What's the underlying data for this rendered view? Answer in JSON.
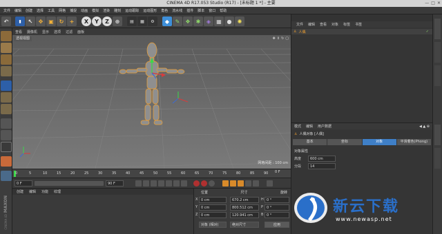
{
  "window": {
    "title": "CINEMA 4D R17.053 Studio (R17) - [未标题 1 *] - 主要",
    "controls": [
      "—",
      "□",
      "✕"
    ]
  },
  "menu": [
    "文件",
    "编辑",
    "创建",
    "选择",
    "工具",
    "网格",
    "捕捉",
    "动画",
    "模拟",
    "渲染",
    "雕刻",
    "运动跟踪",
    "运动图形",
    "角色",
    "流水线",
    "插件",
    "脚本",
    "窗口",
    "帮助"
  ],
  "layout": {
    "label": "界面",
    "value": "启动"
  },
  "toolbar": {
    "axes": [
      "X",
      "Y",
      "Z"
    ]
  },
  "viewport": {
    "menu": [
      "查看",
      "摄像机",
      "显示",
      "选项",
      "过滤",
      "面板"
    ],
    "label": "透视视图",
    "grid_info": "网格间距 : 100 cm"
  },
  "timeline": {
    "ticks": [
      "0",
      "5",
      "10",
      "15",
      "20",
      "25",
      "30",
      "35",
      "40",
      "45",
      "50",
      "55",
      "60",
      "65",
      "70",
      "75",
      "80",
      "85",
      "90"
    ],
    "end": "0 F"
  },
  "transport": {
    "start": "0 F",
    "current": "0 F",
    "end": "90 F",
    "end2": "90 F"
  },
  "materials": {
    "menu": [
      "创建",
      "编辑",
      "功能",
      "纹理"
    ]
  },
  "coords": {
    "headers": [
      "位置",
      "尺寸",
      "旋转"
    ],
    "rows": [
      {
        "axis": "X",
        "pos": "0 cm",
        "size": "670.2 cm",
        "rotl": "H",
        "rot": "0 °"
      },
      {
        "axis": "Y",
        "pos": "0 cm",
        "size": "800.512 cm",
        "rotl": "P",
        "rot": "0 °"
      },
      {
        "axis": "Z",
        "pos": "0 cm",
        "size": "120.941 cm",
        "rotl": "B",
        "rot": "0 °"
      }
    ],
    "mode1": "对象 (相对)",
    "mode2": "绝对尺寸",
    "apply": "应用"
  },
  "objects": {
    "menu": [
      "文件",
      "编辑",
      "查看",
      "对象",
      "标签",
      "书签"
    ],
    "item": "人偶"
  },
  "attributes": {
    "menu": [
      "模式",
      "编辑",
      "用户数据"
    ],
    "object": "人偶对象 [人偶]",
    "tabs": [
      "基本",
      "坐标",
      "对象",
      "平滑着色(Phong)"
    ],
    "active_tab": "对象",
    "section": "对象属性",
    "fields": [
      {
        "label": "高度",
        "value": "600 cm"
      },
      {
        "label": "分段",
        "value": "14"
      }
    ]
  },
  "brand": {
    "maxon": "MAXON",
    "product": "CINEMA 4D"
  },
  "watermark": {
    "cn": "新云下载",
    "url": "www.newasp.net"
  },
  "colors": {
    "accent": "#3f7fc7",
    "x_axis": "#d83b3b",
    "y_axis": "#3bd84b",
    "z_axis": "#3b6bd8",
    "mannequin": "#9a9a9a",
    "highlight": "#f0a030"
  }
}
